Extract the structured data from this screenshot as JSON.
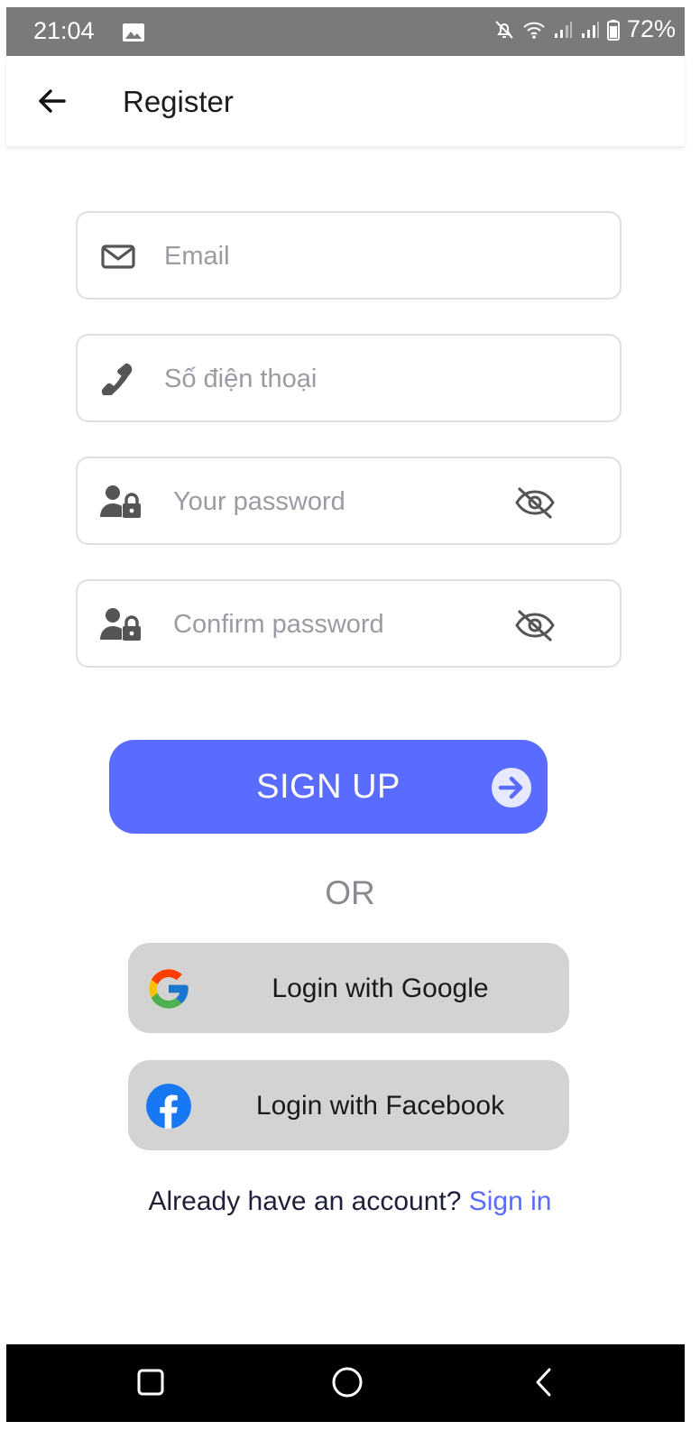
{
  "status_bar": {
    "time": "21:04",
    "battery": "72%",
    "icons": [
      "gallery-icon",
      "mute-icon",
      "wifi-icon",
      "signal-icon",
      "signal-icon",
      "battery-icon"
    ]
  },
  "app_bar": {
    "title": "Register",
    "back_icon": "arrow-left-icon"
  },
  "form": {
    "email": {
      "placeholder": "Email",
      "value": "",
      "icon": "envelope-icon"
    },
    "phone": {
      "placeholder": "Số điện thoại",
      "value": "",
      "icon": "phone-icon"
    },
    "password": {
      "placeholder": "Your password",
      "value": "",
      "icon": "user-lock-icon",
      "toggle_icon": "eye-slash-icon"
    },
    "confirm_password": {
      "placeholder": "Confirm password",
      "value": "",
      "icon": "user-lock-icon",
      "toggle_icon": "eye-slash-icon"
    }
  },
  "signup": {
    "label": "SIGN UP",
    "icon": "arrow-circle-right-icon"
  },
  "divider": {
    "label": "OR"
  },
  "social": {
    "google": {
      "label": "Login with Google",
      "icon": "google-icon"
    },
    "facebook": {
      "label": "Login with Facebook",
      "icon": "facebook-icon"
    }
  },
  "footer": {
    "prompt": "Already have an account?",
    "link": "Sign in"
  },
  "colors": {
    "accent": "#5a6cff",
    "social_bg": "#d3d3d3",
    "status_bar": "#7a7a7a",
    "nav_bar": "#000000"
  }
}
